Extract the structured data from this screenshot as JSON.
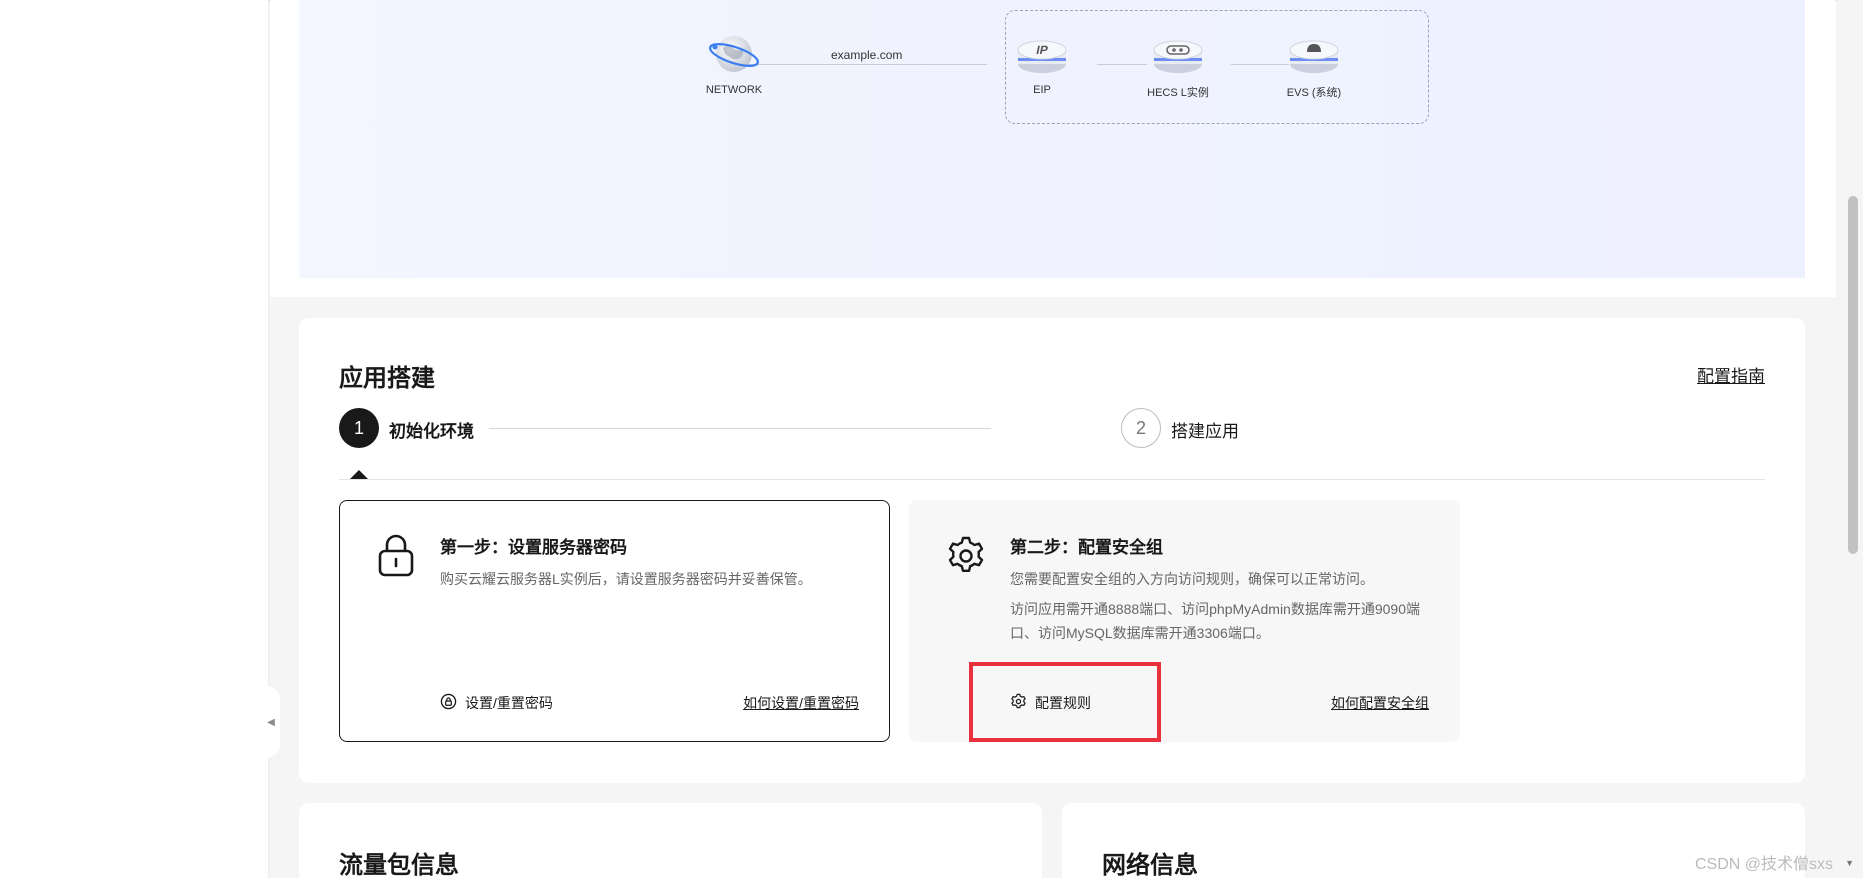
{
  "topology": {
    "domain": "example.com",
    "nodes": [
      {
        "id": "network",
        "label": "NETWORK",
        "icon": "globe-network-icon"
      },
      {
        "id": "eip",
        "label": "EIP",
        "icon": "eip-icon"
      },
      {
        "id": "hecs",
        "label": "HECS L实例",
        "icon": "server-icon"
      },
      {
        "id": "evs",
        "label": "EVS (系统)",
        "icon": "disk-icon"
      }
    ]
  },
  "app": {
    "title": "应用搭建",
    "guide_link": "配置指南",
    "steps": [
      {
        "number": "1",
        "label": "初始化环境",
        "state": "active"
      },
      {
        "number": "2",
        "label": "搭建应用",
        "state": "pending"
      }
    ],
    "tasks": [
      {
        "title": "第一步：设置服务器密码",
        "description": "购买云耀云服务器L实例后，请设置服务器密码并妥善保管。",
        "description_extra": "",
        "icon": "lock-icon",
        "action_icon": "lock-circle-icon",
        "action_label": "设置/重置密码",
        "help_link": "如何设置/重置密码"
      },
      {
        "title": "第二步：配置安全组",
        "description": "您需要配置安全组的入方向访问规则，确保可以正常访问。",
        "description_extra": "访问应用需开通8888端口、访问phpMyAdmin数据库需开通9090端口、访问MySQL数据库需开通3306端口。",
        "icon": "gear-icon",
        "action_icon": "gear-icon",
        "action_label": "配置规则",
        "help_link": "如何配置安全组"
      }
    ]
  },
  "bottom_cards": [
    {
      "title": "流量包信息"
    },
    {
      "title": "网络信息"
    }
  ],
  "watermark": "CSDN @技术僧sxs",
  "colors": {
    "highlight": "#e8313c",
    "active_step": "#191919",
    "topology_bg": "#eef1ff"
  }
}
